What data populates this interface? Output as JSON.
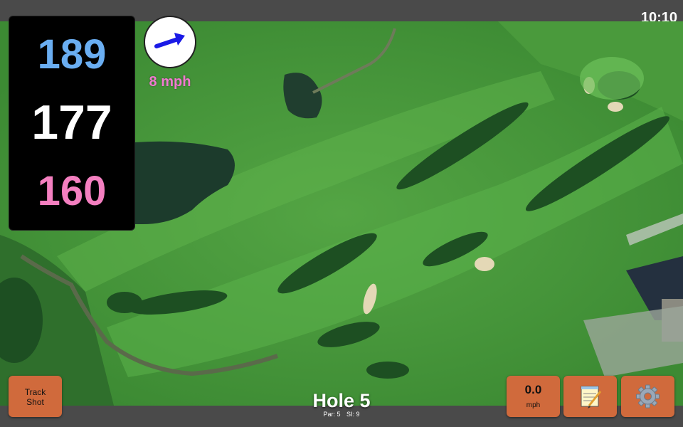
{
  "status_bar": {
    "time": "10:10"
  },
  "distances": {
    "back": "189",
    "middle": "177",
    "front": "160"
  },
  "wind": {
    "speed": "8 mph",
    "direction_icon": "wind-arrow-icon"
  },
  "buttons": {
    "track_shot": "Track\nShot",
    "speed_value": "0.0",
    "speed_unit": "mph",
    "notes_icon": "notepad-icon",
    "settings_icon": "gear-icon"
  },
  "hole": {
    "title": "Hole 5",
    "par": "Par: 5",
    "si": "SI: 9"
  },
  "colors": {
    "back_distance": "#6aaef2",
    "middle_distance": "#ffffff",
    "front_distance": "#f47fc0",
    "wind_text": "#f07ad0",
    "button": "#d06a3c",
    "wind_arrow": "#1a1ae6"
  }
}
